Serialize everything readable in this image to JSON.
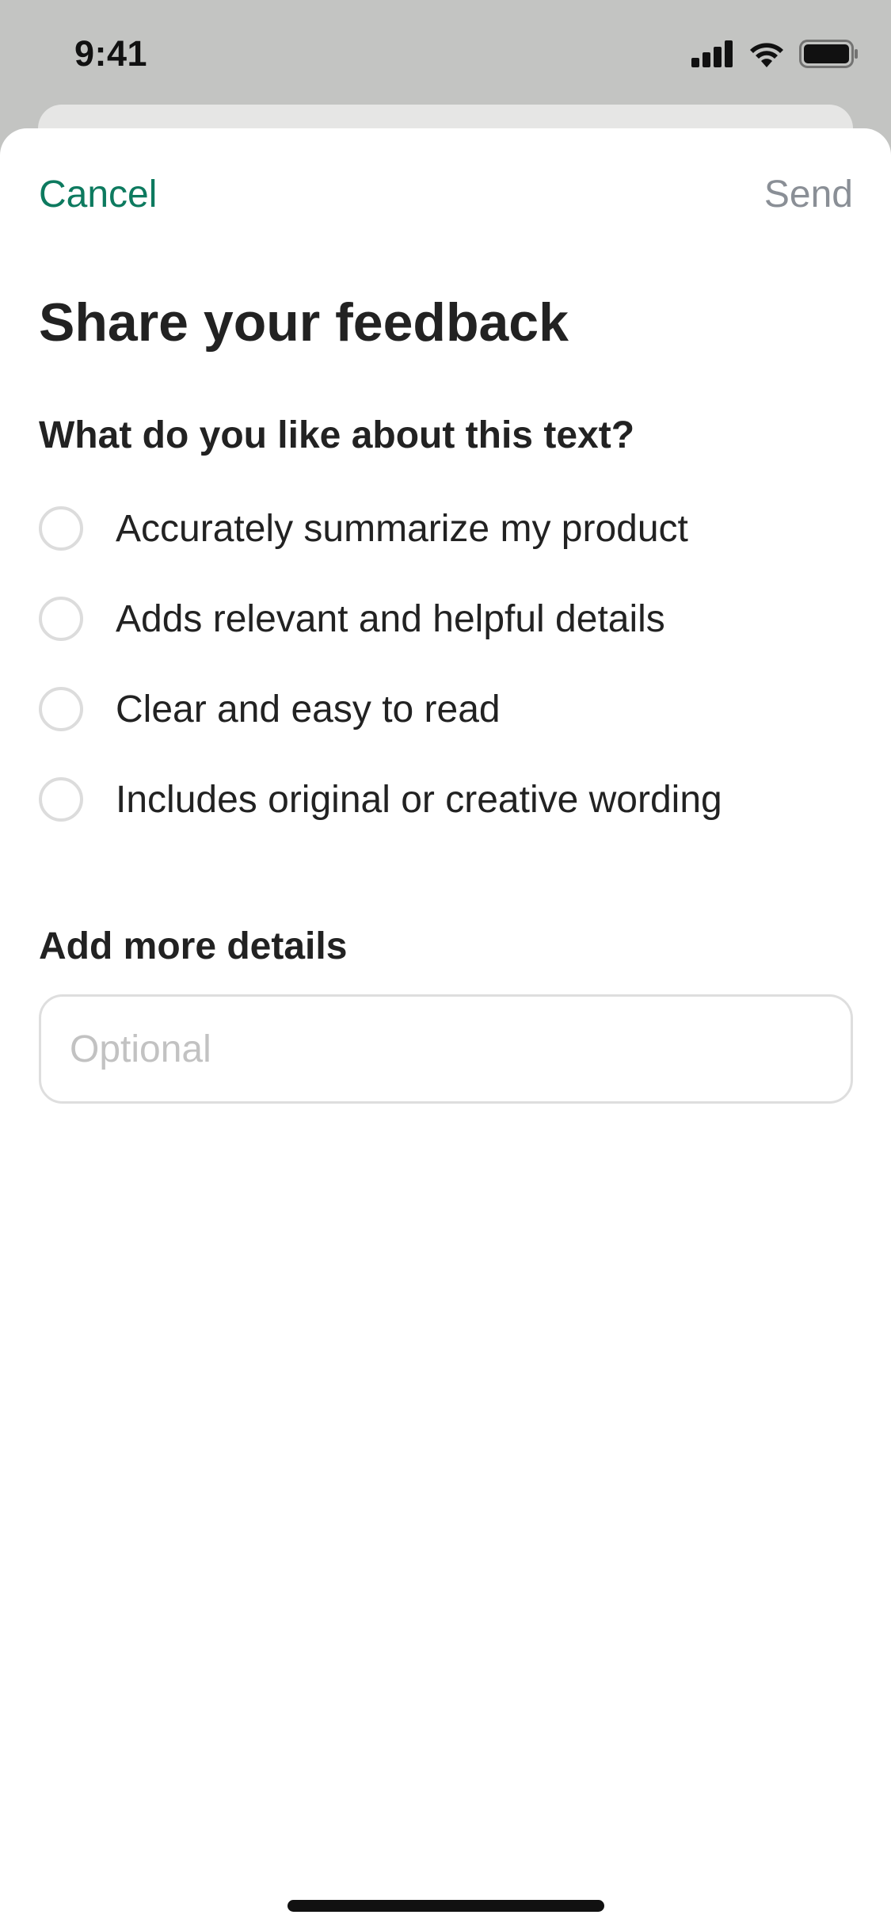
{
  "status_bar": {
    "time": "9:41",
    "icons": [
      "cellular-signal-icon",
      "wifi-icon",
      "battery-icon"
    ]
  },
  "nav": {
    "cancel_label": "Cancel",
    "send_label": "Send"
  },
  "title": "Share your feedback",
  "question": "What do you like about this text?",
  "options": [
    {
      "label": "Accurately summarize my product",
      "selected": false
    },
    {
      "label": "Adds relevant and helpful details",
      "selected": false
    },
    {
      "label": "Clear and easy to read",
      "selected": false
    },
    {
      "label": "Includes original or creative wording",
      "selected": false
    }
  ],
  "details": {
    "label": "Add more details",
    "value": "",
    "placeholder": "Optional"
  },
  "colors": {
    "accent": "#0d7a5f",
    "disabled": "#8a8f96",
    "background_dim": "#c3c4c2"
  }
}
